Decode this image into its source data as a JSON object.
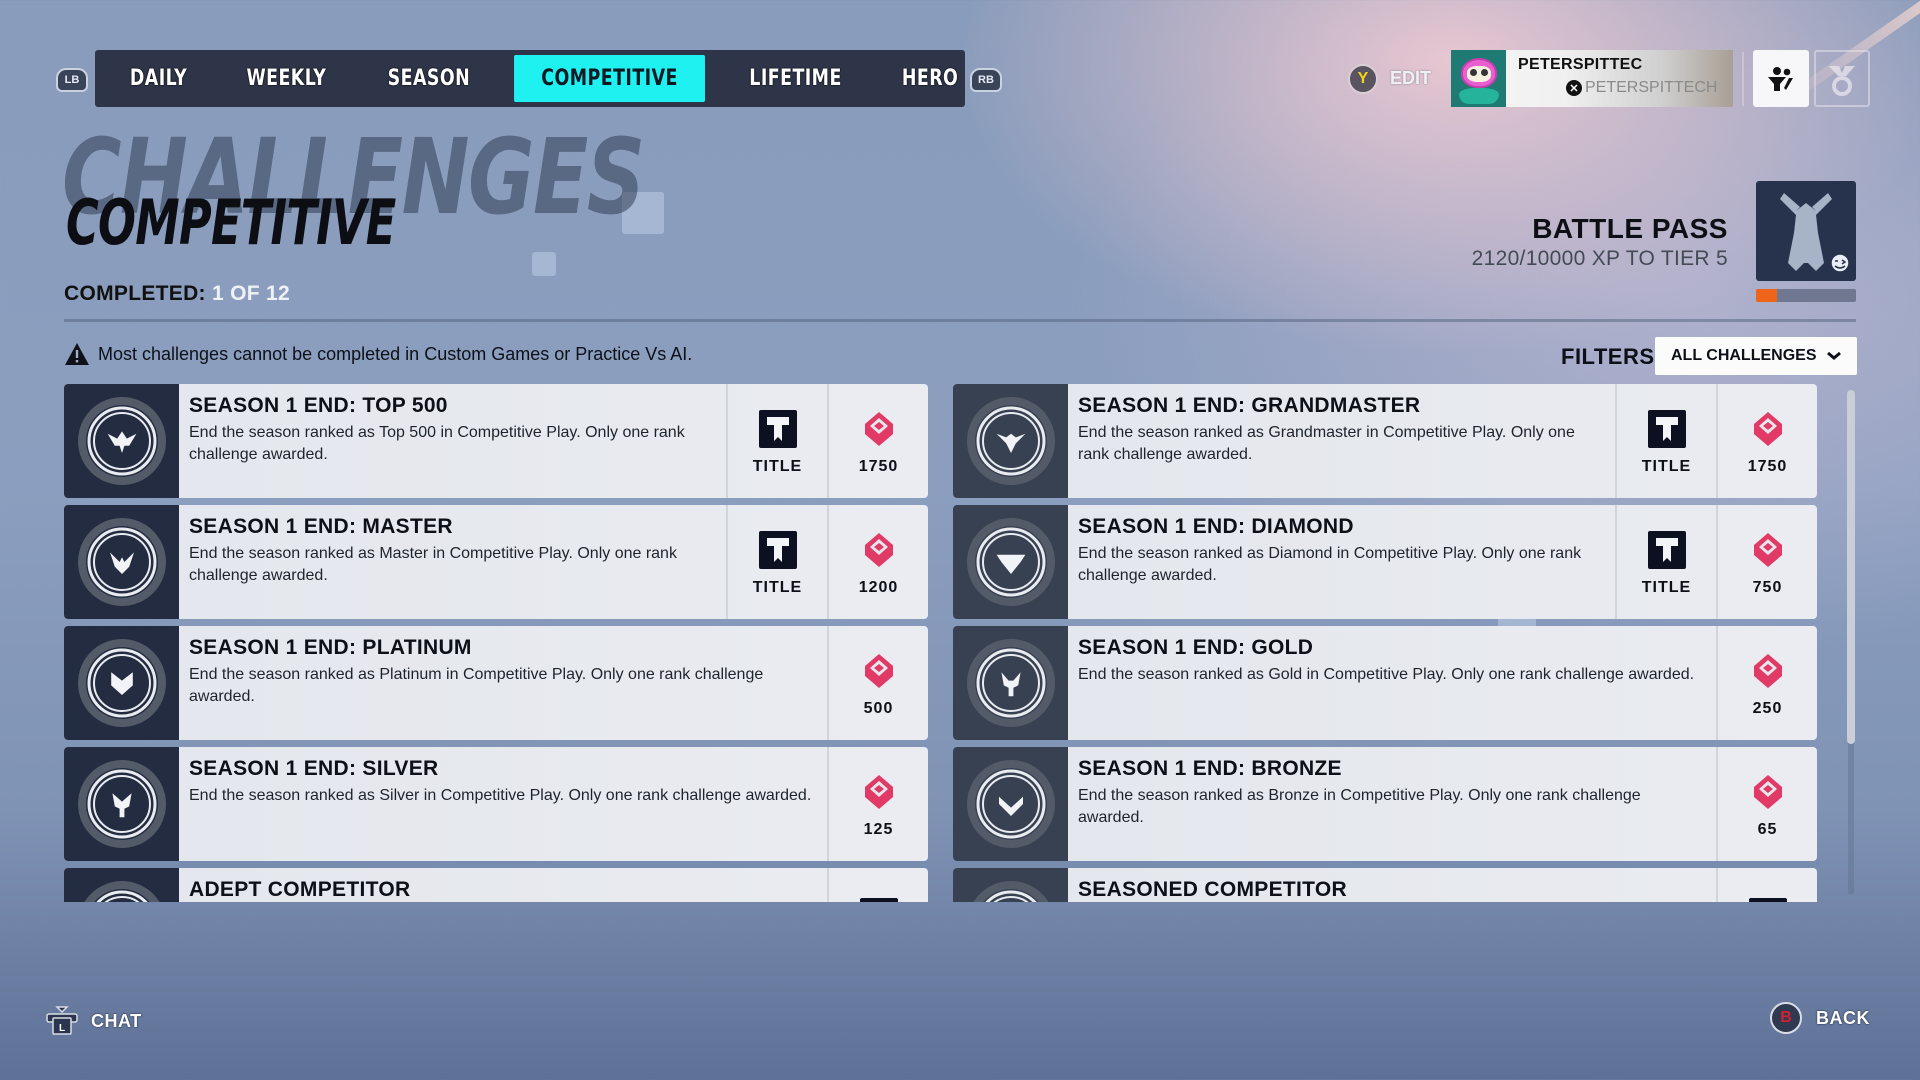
{
  "nav": {
    "left_bumper": "LB",
    "right_bumper": "RB",
    "tabs": [
      {
        "label": "DAILY",
        "active": false
      },
      {
        "label": "WEEKLY",
        "active": false
      },
      {
        "label": "SEASON",
        "active": false
      },
      {
        "label": "COMPETITIVE",
        "active": true
      },
      {
        "label": "LIFETIME",
        "active": false
      },
      {
        "label": "HERO",
        "active": false
      }
    ]
  },
  "profile": {
    "edit_button_glyph": "Y",
    "edit_label": "EDIT",
    "player_name": "PETERSPITTEC",
    "platform_tag": "PETERSPITTECH",
    "platform_icon": "xbox-icon",
    "social_icon": "group-icon",
    "medal_icon": "medal-icon"
  },
  "header": {
    "background_title": "CHALLENGES",
    "title": "COMPETITIVE",
    "completed_label": "COMPLETED:",
    "completed_value": "1 OF 12"
  },
  "battle_pass": {
    "title": "BATTLE PASS",
    "xp_text": "2120/10000 XP TO TIER 5",
    "progress_fraction": 0.212
  },
  "warning": {
    "icon": "warning-icon",
    "text": "Most challenges cannot be completed in Custom Games or Practice Vs AI."
  },
  "filters": {
    "label": "FILTERS",
    "selected": "ALL CHALLENGES"
  },
  "challenges": [
    {
      "title": "SEASON 1 END: TOP 500",
      "description": "End the season ranked as Top 500 in Competitive Play. Only one rank challenge awarded.",
      "rank_icon": "top500-rank-icon",
      "title_reward": "TITLE",
      "coins": "1750"
    },
    {
      "title": "SEASON 1 END: GRANDMASTER",
      "description": "End the season ranked as Grandmaster in Competitive Play. Only one rank challenge awarded.",
      "rank_icon": "grandmaster-rank-icon",
      "title_reward": "TITLE",
      "coins": "1750"
    },
    {
      "title": "SEASON 1 END: MASTER",
      "description": "End the season ranked as Master in Competitive Play. Only one rank challenge awarded.",
      "rank_icon": "master-rank-icon",
      "title_reward": "TITLE",
      "coins": "1200"
    },
    {
      "title": "SEASON 1 END: DIAMOND",
      "description": "End the season ranked as Diamond in Competitive Play. Only one rank challenge awarded.",
      "rank_icon": "diamond-rank-icon",
      "title_reward": "TITLE",
      "coins": "750"
    },
    {
      "title": "SEASON 1 END: PLATINUM",
      "description": "End the season ranked as Platinum in Competitive Play. Only one rank challenge awarded.",
      "rank_icon": "platinum-rank-icon",
      "title_reward": null,
      "coins": "500"
    },
    {
      "title": "SEASON 1 END: GOLD",
      "description": "End the season ranked as Gold in Competitive Play. Only one rank challenge awarded.",
      "rank_icon": "gold-rank-icon",
      "title_reward": null,
      "coins": "250"
    },
    {
      "title": "SEASON 1 END: SILVER",
      "description": "End the season ranked as Silver in Competitive Play. Only one rank challenge awarded.",
      "rank_icon": "silver-rank-icon",
      "title_reward": null,
      "coins": "125"
    },
    {
      "title": "SEASON 1 END: BRONZE",
      "description": "End the season ranked as Bronze in Competitive Play. Only one rank challenge awarded.",
      "rank_icon": "bronze-rank-icon",
      "title_reward": null,
      "coins": "65"
    },
    {
      "title": "ADEPT COMPETITOR",
      "description": "",
      "rank_icon": "competitor-icon",
      "title_reward": null,
      "coins": null,
      "partial": true
    },
    {
      "title": "SEASONED COMPETITOR",
      "description": "",
      "rank_icon": "competitor-icon",
      "title_reward": null,
      "coins": null,
      "partial": true
    }
  ],
  "scroll": {
    "position_fraction": 0.0,
    "visible_fraction": 0.7
  },
  "footer": {
    "chat_button_glyph": "L",
    "chat_label": "CHAT",
    "back_button_glyph": "B",
    "back_label": "BACK"
  },
  "colors": {
    "active_tab": "#1ff0f0",
    "coin": "#e23a66",
    "progress": "#ee6419",
    "nav_bg": "#2e3548"
  }
}
